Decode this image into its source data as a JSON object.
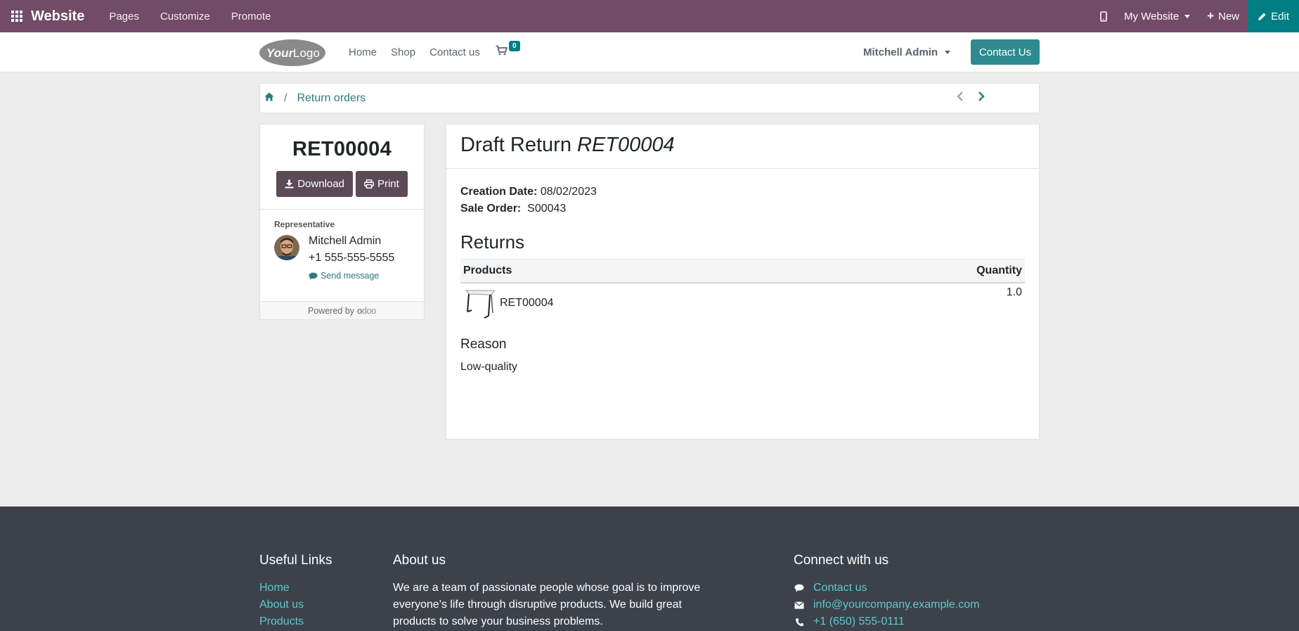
{
  "adminbar": {
    "brand": "Website",
    "menus": [
      "Pages",
      "Customize",
      "Promote"
    ],
    "site_selector": "My Website",
    "new_label": "New",
    "edit_label": "Edit"
  },
  "header": {
    "nav": [
      "Home",
      "Shop",
      "Contact us"
    ],
    "cart_count": "0",
    "user": "Mitchell Admin",
    "contact_button": "Contact Us"
  },
  "breadcrumb": {
    "current": "Return orders",
    "sep": "/"
  },
  "sidebar": {
    "reference": "RET00004",
    "download_label": "Download",
    "print_label": "Print",
    "rep_label": "Representative",
    "rep_name": "Mitchell Admin",
    "rep_phone": "+1 555-555-5555",
    "send_message": "Send message",
    "powered_by": "Powered by",
    "powered_brand": "odoo"
  },
  "main": {
    "title_prefix": "Draft Return",
    "title_ref": "RET00004",
    "creation_label": "Creation Date:",
    "creation_value": "08/02/2023",
    "sale_label": "Sale Order:",
    "sale_value": "S00043",
    "returns_title": "Returns",
    "table": {
      "col_products": "Products",
      "col_quantity": "Quantity",
      "rows": [
        {
          "product": "RET00004",
          "quantity": "1.0"
        }
      ]
    },
    "reason_title": "Reason",
    "reason_text": "Low-quality"
  },
  "footer": {
    "useful_title": "Useful Links",
    "useful_links": [
      "Home",
      "About us",
      "Products"
    ],
    "about_title": "About us",
    "about_text": "We are a team of passionate people whose goal is to improve everyone's life through disruptive products. We build great products to solve your business problems.",
    "connect_title": "Connect with us",
    "contact_us": "Contact us",
    "email": "info@yourcompany.example.com",
    "phone": "+1 (650) 555-0111"
  },
  "colors": {
    "adminbar": "#714b67",
    "edit": "#017e84",
    "accent": "#2a7b81",
    "footer": "#3c414a"
  }
}
